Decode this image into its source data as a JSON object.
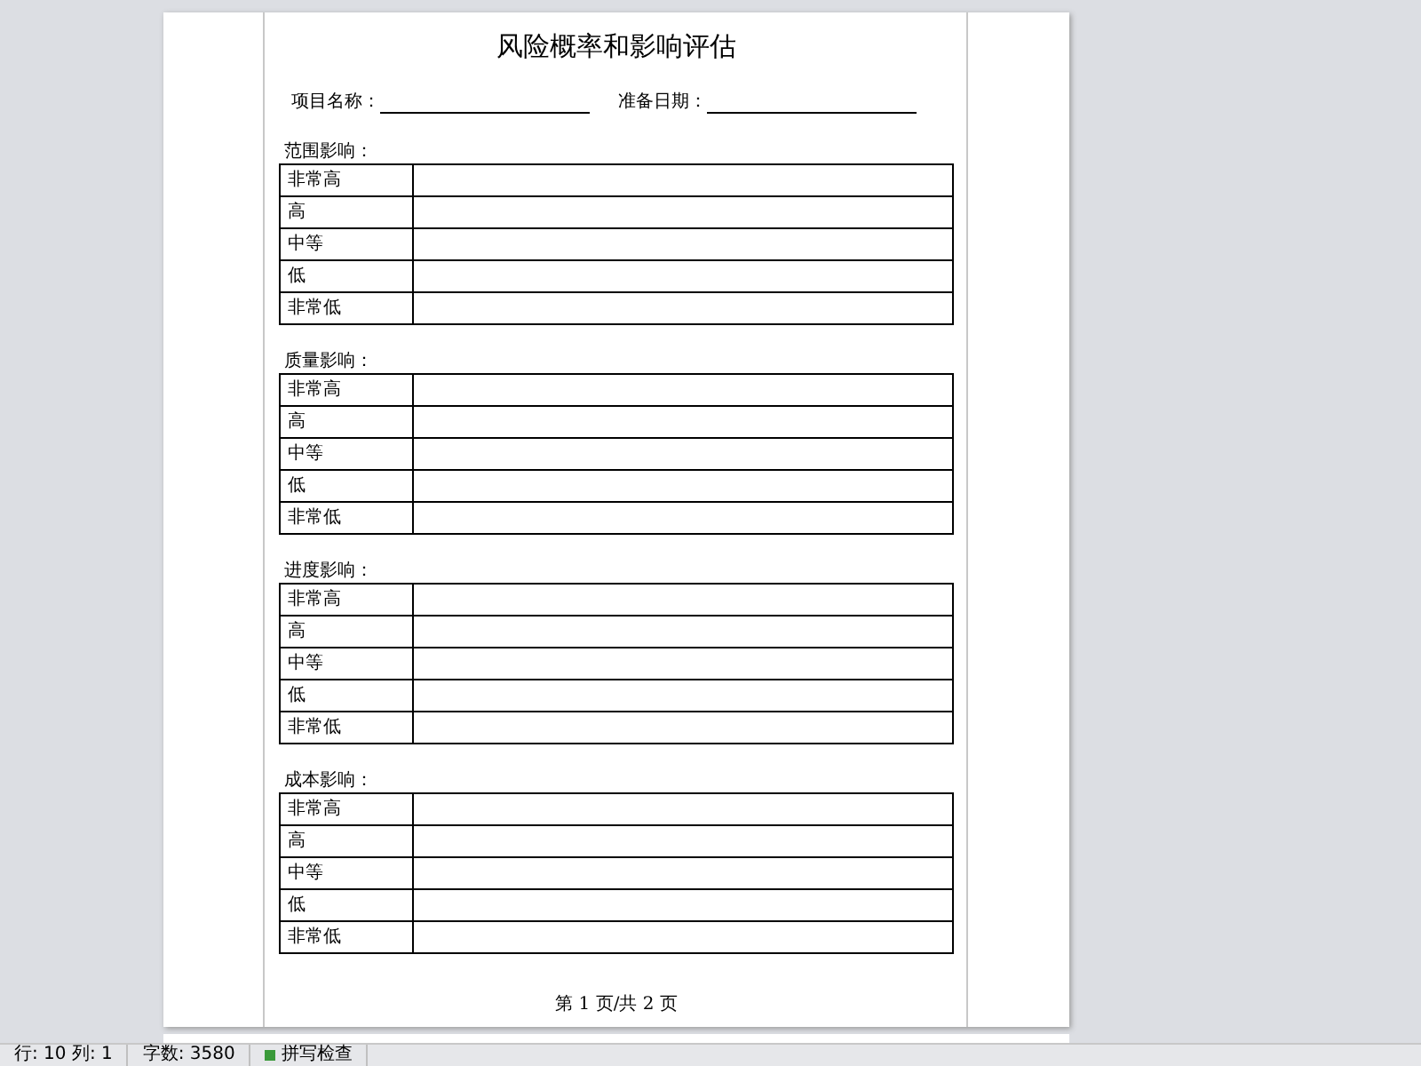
{
  "document": {
    "title": "风险概率和影响评估",
    "fields": [
      {
        "label": "项目名称："
      },
      {
        "label": "准备日期："
      }
    ],
    "sections": [
      {
        "heading": "范围影响：",
        "rows": [
          "非常高",
          "高",
          "中等",
          "低",
          "非常低"
        ]
      },
      {
        "heading": "质量影响：",
        "rows": [
          "非常高",
          "高",
          "中等",
          "低",
          "非常低"
        ]
      },
      {
        "heading": "进度影响：",
        "rows": [
          "非常高",
          "高",
          "中等",
          "低",
          "非常低"
        ]
      },
      {
        "heading": "成本影响：",
        "rows": [
          "非常高",
          "高",
          "中等",
          "低",
          "非常低"
        ]
      }
    ],
    "footer": "第 1 页/共 2 页"
  },
  "status_bar": {
    "items": [
      {
        "kind": "text",
        "text": "行: 10 列: 1"
      },
      {
        "kind": "text",
        "text": "字数: 3580"
      },
      {
        "kind": "check",
        "text": "拼写检查"
      }
    ]
  }
}
